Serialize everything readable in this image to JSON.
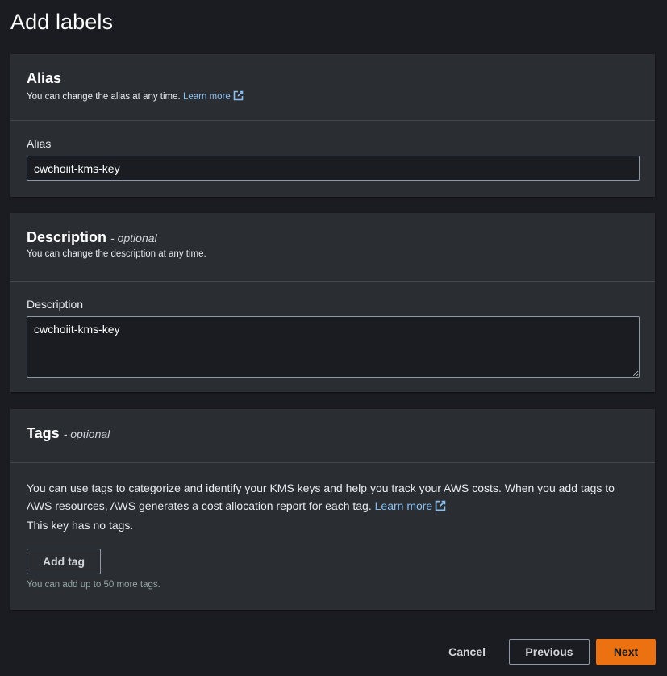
{
  "page": {
    "title": "Add labels"
  },
  "alias": {
    "title": "Alias",
    "description": "You can change the alias at any time.",
    "learn_more": "Learn more",
    "field_label": "Alias",
    "value": "cwchoiit-kms-key"
  },
  "description": {
    "title": "Description",
    "optional": "- optional",
    "description": "You can change the description at any time.",
    "field_label": "Description",
    "value": "cwchoiit-kms-key"
  },
  "tags": {
    "title": "Tags",
    "optional": "- optional",
    "info_text": "You can use tags to categorize and identify your KMS keys and help you track your AWS costs. When you add tags to AWS resources, AWS generates a cost allocation report for each tag.",
    "learn_more": "Learn more",
    "empty_text": "This key has no tags.",
    "add_button": "Add tag",
    "hint": "You can add up to 50 more tags."
  },
  "footer": {
    "cancel": "Cancel",
    "previous": "Previous",
    "next": "Next"
  },
  "colors": {
    "background": "#1b1c21",
    "card": "#2a2e33",
    "link": "#89bdee",
    "primary": "#ec7211"
  },
  "icons": {
    "external_link": "external-link-icon"
  }
}
